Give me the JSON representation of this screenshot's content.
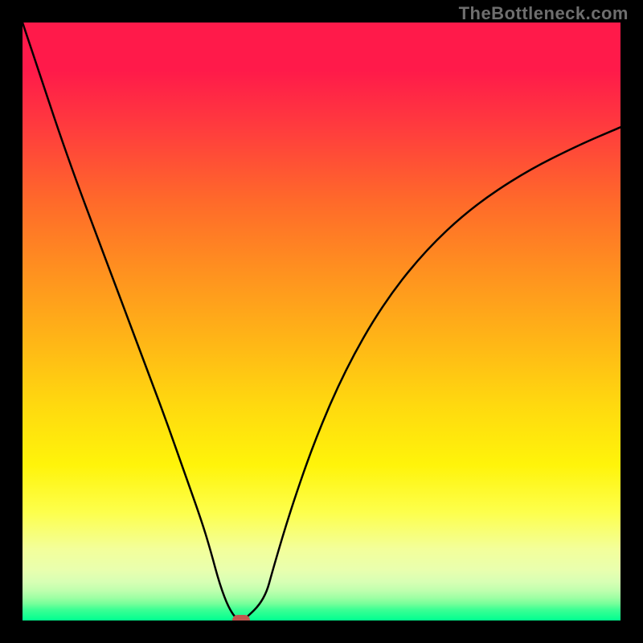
{
  "watermark": "TheBottleneck.com",
  "chart_data": {
    "type": "line",
    "title": "",
    "xlabel": "",
    "ylabel": "",
    "xlim": [
      0,
      100
    ],
    "ylim": [
      0,
      100
    ],
    "grid": false,
    "legend": false,
    "background_gradient": {
      "direction": "vertical",
      "stops": [
        {
          "pos": 0.0,
          "color": "#ff1a4a"
        },
        {
          "pos": 0.3,
          "color": "#ff6a2a"
        },
        {
          "pos": 0.55,
          "color": "#ffc312"
        },
        {
          "pos": 0.78,
          "color": "#fff40a"
        },
        {
          "pos": 0.92,
          "color": "#e9ffae"
        },
        {
          "pos": 1.0,
          "color": "#00ff90"
        }
      ]
    },
    "series": [
      {
        "name": "bottleneck-curve",
        "x": [
          0.0,
          3.0,
          6.0,
          9.0,
          12.0,
          15.0,
          18.0,
          21.0,
          24.0,
          27.0,
          30.0,
          31.5,
          33.0,
          34.5,
          36.0,
          37.0,
          40.5,
          42.0,
          45.0,
          49.0,
          54.0,
          60.0,
          67.0,
          75.0,
          84.0,
          93.0,
          100.0
        ],
        "y": [
          100.0,
          91.0,
          82.0,
          73.5,
          65.5,
          57.5,
          49.5,
          41.5,
          33.5,
          25.0,
          16.5,
          11.5,
          6.0,
          2.0,
          0.0,
          0.0,
          3.5,
          9.0,
          19.0,
          30.5,
          42.0,
          52.5,
          61.5,
          69.0,
          75.0,
          79.5,
          82.5
        ],
        "stroke": "#000000",
        "stroke_width": 2.5
      }
    ],
    "marker": {
      "name": "optimal-point",
      "x": 36.5,
      "y": 0.0,
      "color": "#c3574e",
      "shape": "rounded-rect"
    }
  }
}
